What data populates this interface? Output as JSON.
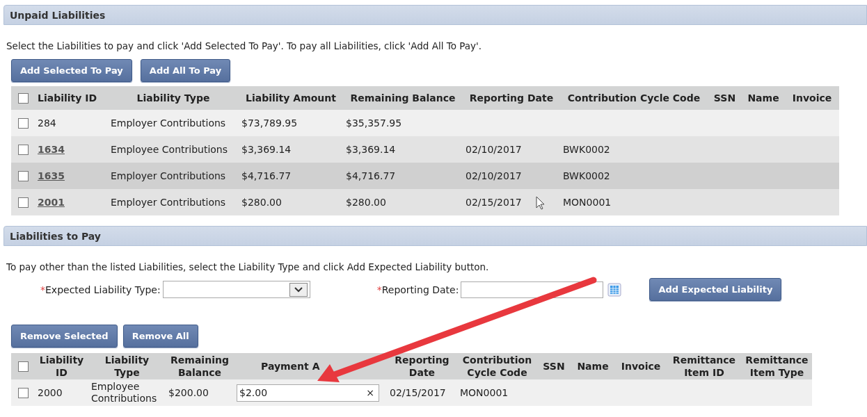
{
  "unpaid": {
    "title": "Unpaid Liabilities",
    "instructions": "Select the Liabilities to pay and click 'Add Selected To Pay'. To pay all Liabilities, click 'Add All To Pay'.",
    "buttons": [
      "Add Selected To Pay",
      "Add All To Pay"
    ],
    "table": {
      "select_all_checked": false,
      "columns": [
        "Liability ID",
        "Liability Type",
        "Liability Amount",
        "Remaining Balance",
        "Reporting Date",
        "Contribution Cycle Code",
        "SSN",
        "Name",
        "Invoice"
      ],
      "rows": [
        {
          "checked": false,
          "highlighted": false,
          "kind": "plain",
          "cells": [
            "284",
            "Employer Contributions",
            "$73,789.95",
            "$35,357.95",
            "",
            "",
            "",
            "",
            ""
          ]
        },
        {
          "checked": false,
          "highlighted": false,
          "kind": "link",
          "cells": [
            "1634",
            "Employee Contributions",
            "$3,369.14",
            "$3,369.14",
            "02/10/2017",
            "BWK0002",
            "",
            "",
            ""
          ]
        },
        {
          "checked": false,
          "highlighted": true,
          "kind": "link",
          "cells": [
            "1635",
            "Employer Contributions",
            "$4,716.77",
            "$4,716.77",
            "02/10/2017",
            "BWK0002",
            "",
            "",
            ""
          ]
        },
        {
          "checked": false,
          "highlighted": false,
          "kind": "link",
          "cells": [
            "2001",
            "Employer Contributions",
            "$280.00",
            "$280.00",
            "02/15/2017",
            "MON0001",
            "",
            "",
            ""
          ]
        }
      ]
    }
  },
  "to_pay": {
    "title": "Liabilities to Pay",
    "instructions": "To pay other than the listed Liabilities, select the Liability Type and click Add Expected Liability button.",
    "required_mark": "*",
    "type_label": "Expected Liability Type:",
    "date_label": "Reporting Date:",
    "add_button": "Add Expected Liability",
    "buttons": [
      "Remove Selected",
      "Remove All"
    ],
    "table": {
      "select_all_checked": false,
      "columns": [
        "Liability ID",
        "Liability Type",
        "Remaining Balance",
        "Payment A",
        "Reporting Date",
        "Contribution Cycle Code",
        "SSN",
        "Name",
        "Invoice",
        "Remittance Item ID",
        "Remittance Item Type"
      ],
      "rows": [
        {
          "checked": false,
          "id": "2000",
          "type": "Employee Contributions",
          "remaining": "$200.00",
          "payment": "$2.00",
          "clear": "×",
          "date": "02/15/2017",
          "cycle": "MON0001"
        }
      ]
    }
  }
}
